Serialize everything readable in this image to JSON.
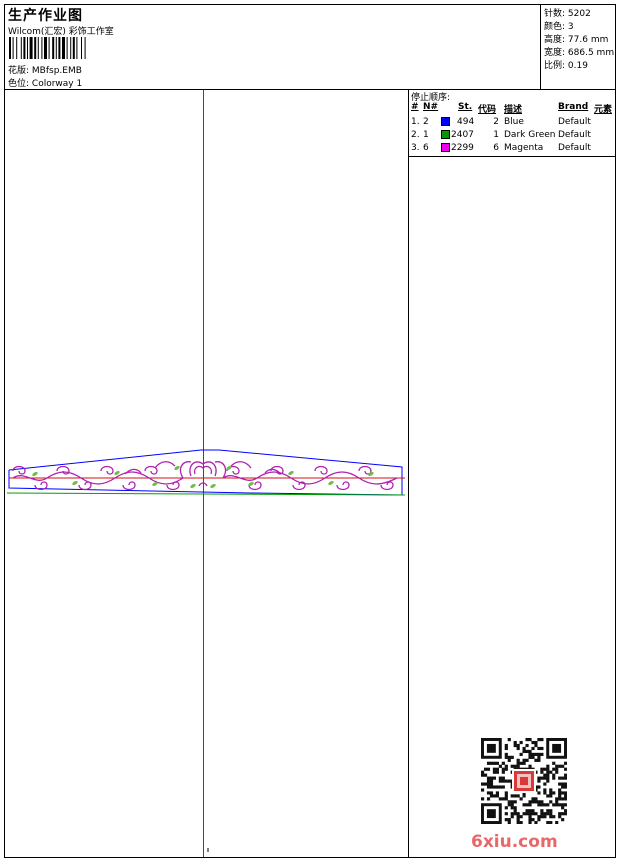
{
  "header": {
    "title": "生产作业图",
    "studio": "Wilcom(汇宏) 彩饰工作室",
    "design_label": "花版:",
    "design_value": "MBfsp.EMB",
    "colorway_label": "色位:",
    "colorway_value": "Colorway 1"
  },
  "stats": [
    {
      "label": "针数:",
      "value": "5202"
    },
    {
      "label": "颜色:",
      "value": "3"
    },
    {
      "label": "高度:",
      "value": "77.6 mm"
    },
    {
      "label": "宽度:",
      "value": "686.5 mm"
    },
    {
      "label": "比例:",
      "value": "0.19"
    }
  ],
  "stop_sequence": {
    "title": "停止顺序:",
    "columns": [
      "#",
      "N#",
      "St.",
      "代码",
      "描述",
      "Brand",
      "元素"
    ],
    "rows": [
      {
        "index": "1.",
        "needle": "2",
        "color": "#0000ff",
        "stitches": "494",
        "code": "2",
        "description": "Blue",
        "brand": "Default"
      },
      {
        "index": "2.",
        "needle": "1",
        "color": "#009a00",
        "stitches": "2407",
        "code": "1",
        "description": "Dark Green",
        "brand": "Default"
      },
      {
        "index": "3.",
        "needle": "6",
        "color": "#ee00ee",
        "stitches": "2299",
        "code": "6",
        "description": "Magenta",
        "brand": "Default"
      }
    ]
  },
  "colors": {
    "guide_line": "#d01010",
    "outline_blue": "#0000ff",
    "outline_green": "#00a000",
    "embroidery_magenta": "#b020b0"
  },
  "watermark": "6xiu.com",
  "icons": {
    "barcode": "barcode-icon",
    "qr": "qr-code-icon"
  }
}
